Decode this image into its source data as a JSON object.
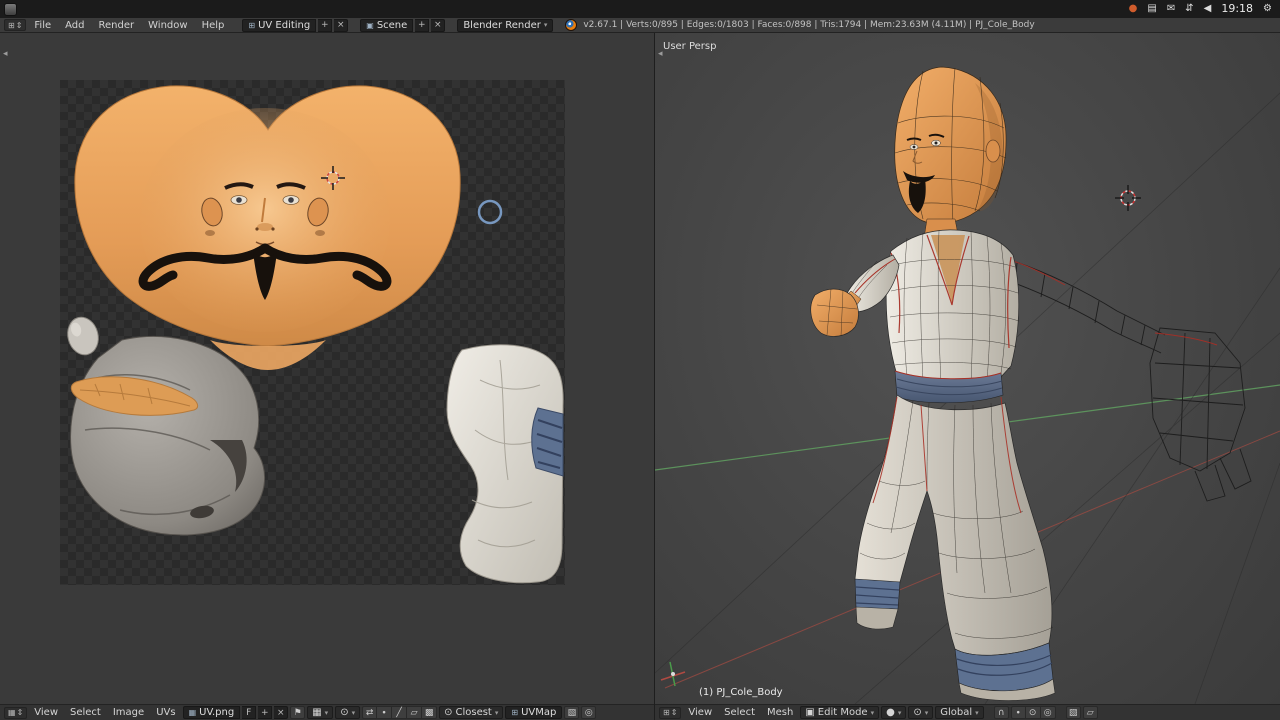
{
  "system_bar": {
    "time": "19:18"
  },
  "info_header": {
    "menus": [
      "File",
      "Add",
      "Render",
      "Window",
      "Help"
    ],
    "layout_name": "UV Editing",
    "scene_name": "Scene",
    "engine_name": "Blender Render",
    "stats": "v2.67.1 | Verts:0/895 | Edges:0/1803 | Faces:0/898 | Tris:1794 | Mem:23.63M (4.11M) | PJ_Cole_Body"
  },
  "uv_editor": {
    "menus": [
      "View",
      "Select",
      "Image",
      "UVs"
    ],
    "image_name": "UV.png",
    "fake_user": "F",
    "snap_mode": "Closest",
    "uv_map_name": "UVMap"
  },
  "viewport": {
    "view_label": "User Persp",
    "object_label": "(1) PJ_Cole_Body",
    "menus": [
      "View",
      "Select",
      "Mesh"
    ],
    "mode": "Edit Mode",
    "orientation": "Global"
  },
  "colors": {
    "skin": "#e29c5a",
    "cloth_gray": "#cfcabf",
    "belt_blue": "#5d7191",
    "seam_red": "#a83228",
    "axis_green": "#5f9b5f",
    "axis_red": "#9b4a42",
    "header_bg": "#3b3b3b",
    "canvas_bg": "#3a3a3a"
  },
  "icons": {
    "chevron": "▾",
    "updown": "⇕",
    "plus": "+",
    "close": "×",
    "pin": "⚑",
    "image": "▦",
    "scene": "▣",
    "screen": "⊞",
    "pivot": "⊙",
    "shading": "●",
    "magnet": "∩",
    "sync": "⇄",
    "vertex": "∙",
    "edge": "╱",
    "face": "▱",
    "island": "▩",
    "mail": "✉",
    "network": "⇵",
    "keyboard": "▤",
    "status_dot": "●",
    "gear": "⚙",
    "volume": "◀",
    "proportional": "◎",
    "render_small": "▧",
    "mode_cube": "▣",
    "arrow_left": "◂"
  }
}
